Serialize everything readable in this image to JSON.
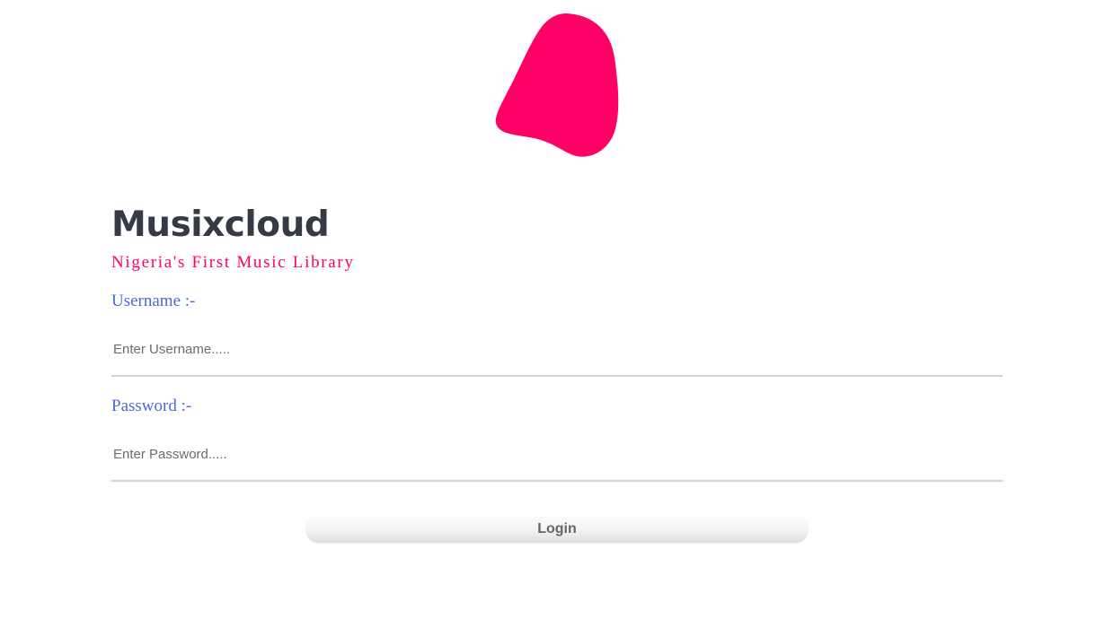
{
  "brand": {
    "title": "Musixcloud",
    "tagline": "Nigeria's First Music Library",
    "logo_color": "#ff0066",
    "logo": "pink-blob-logo"
  },
  "form": {
    "username": {
      "label": "Username :-",
      "placeholder": "Enter Username.....",
      "value": ""
    },
    "password": {
      "label": "Password :-",
      "placeholder": "Enter Password.....",
      "value": ""
    },
    "login_label": "Login"
  },
  "colors": {
    "title": "#363a45",
    "tagline": "#ff0066",
    "field_label": "#4a6bd4",
    "input_underline": "#d3d3d6",
    "button_text": "#666666"
  }
}
